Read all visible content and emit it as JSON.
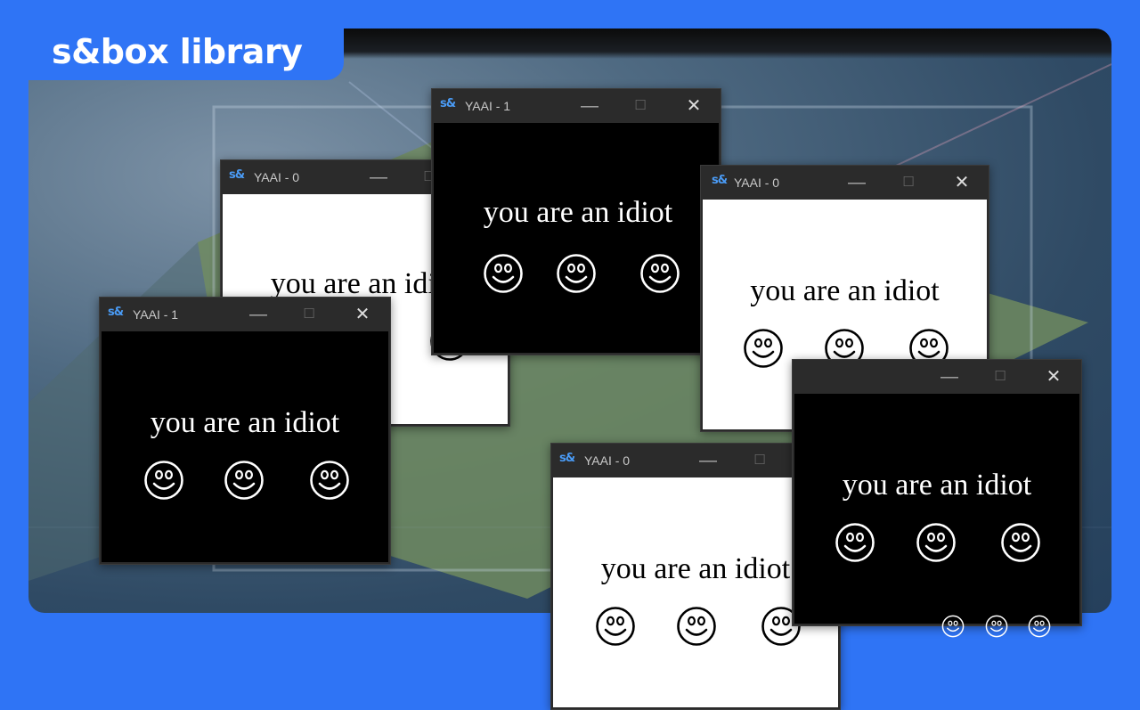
{
  "badge": {
    "text": "s&box library"
  },
  "window_controls": {
    "minimize": "—",
    "maximize": "☐",
    "close": "✕"
  },
  "logo_text": "s&",
  "message": "you are an idiot",
  "windows": [
    {
      "title": "YAAI - 0",
      "theme": "white"
    },
    {
      "title": "YAAI - 1",
      "theme": "black"
    },
    {
      "title": "YAAI - 0",
      "theme": "white"
    },
    {
      "title": "YAAI - 1",
      "theme": "black"
    },
    {
      "title": "YAAI - 0",
      "theme": "white"
    },
    {
      "title": "",
      "theme": "black"
    }
  ],
  "colors": {
    "brand": "#2f74f5",
    "logo": "#4a9bf5"
  },
  "icons": [
    "smiley-icon",
    "minimize-icon",
    "maximize-icon",
    "close-icon",
    "sbox-logo-icon"
  ]
}
